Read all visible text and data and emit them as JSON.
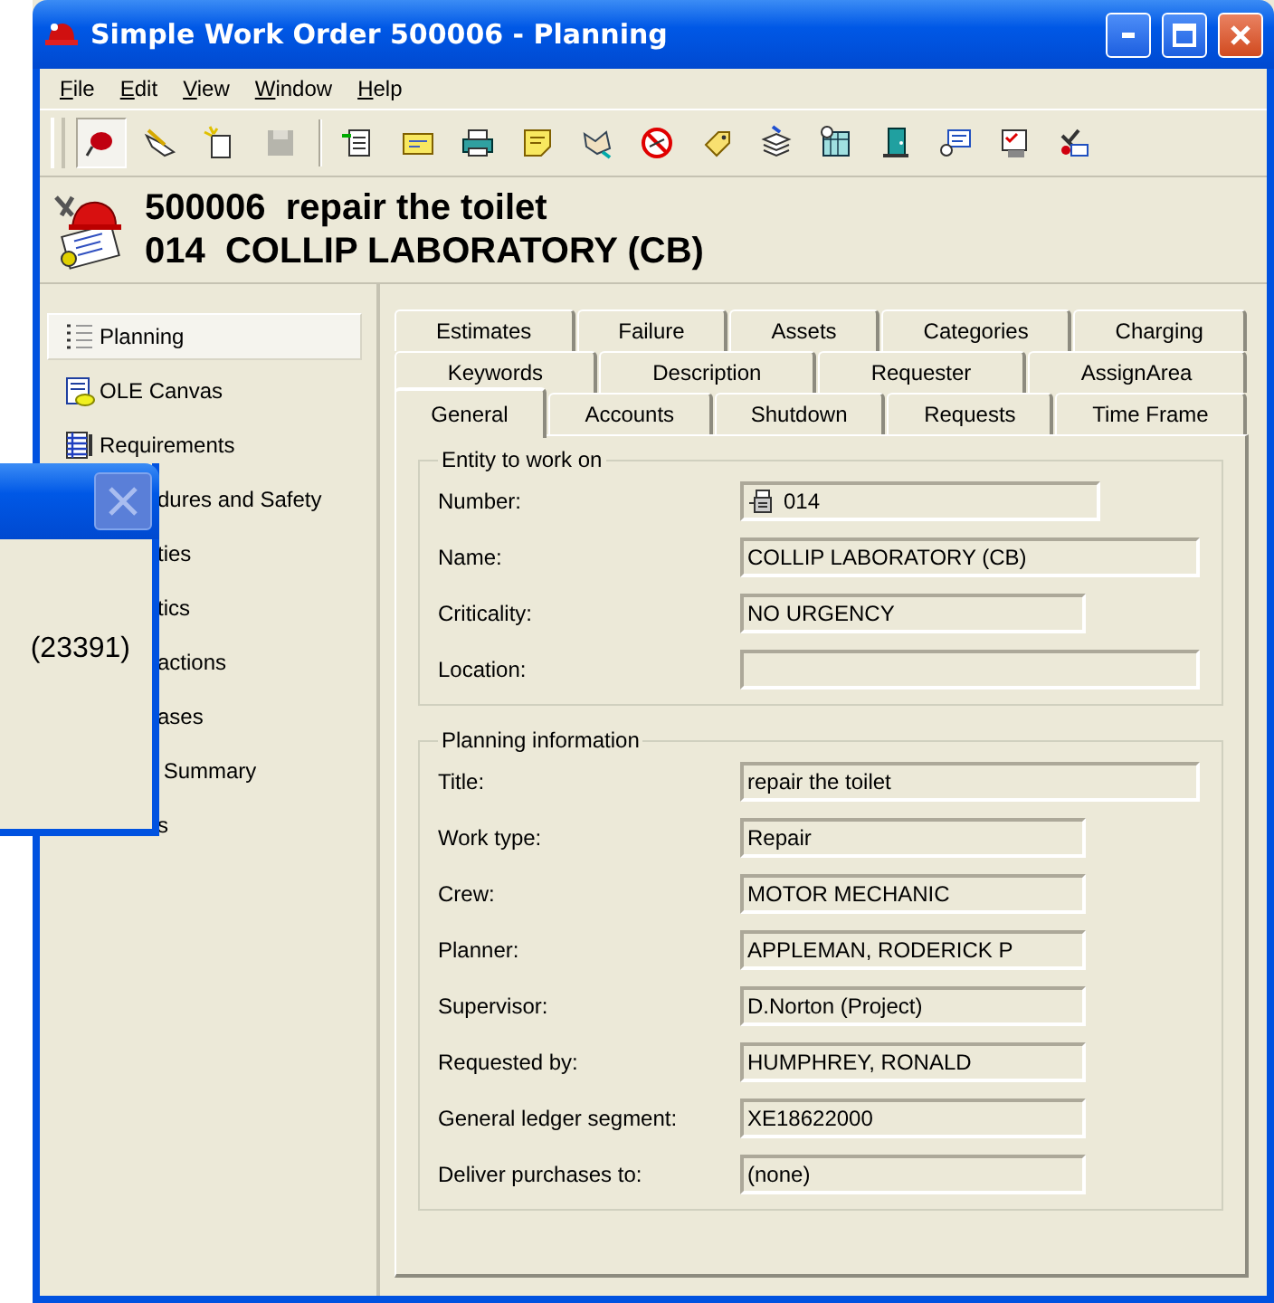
{
  "window": {
    "title": "Simple Work Order 500006 - Planning"
  },
  "menu": [
    "File",
    "Edit",
    "View",
    "Window",
    "Help"
  ],
  "toolbar": [
    {
      "buttons": [
        {
          "pressed": true,
          "disabled": false
        },
        {
          "pressed": false,
          "disabled": false
        },
        {
          "pressed": false,
          "disabled": false
        },
        {
          "pressed": false,
          "disabled": true
        }
      ]
    },
    {
      "buttons": [
        {
          "pressed": false,
          "disabled": false
        },
        {
          "pressed": false,
          "disabled": false
        },
        {
          "pressed": false,
          "disabled": false
        },
        {
          "pressed": false,
          "disabled": false
        },
        {
          "pressed": false,
          "disabled": false
        },
        {
          "pressed": false,
          "disabled": false
        },
        {
          "pressed": false,
          "disabled": false
        },
        {
          "pressed": false,
          "disabled": false
        },
        {
          "pressed": false,
          "disabled": false
        },
        {
          "pressed": false,
          "disabled": false
        },
        {
          "pressed": false,
          "disabled": false
        },
        {
          "pressed": false,
          "disabled": false
        },
        {
          "pressed": false,
          "disabled": false
        }
      ]
    }
  ],
  "header": {
    "line_1": "500006  repair the toilet",
    "line_2": "014  COLLIP LABORATORY (CB)"
  },
  "sidebar": {
    "items": [
      {
        "label": "Planning",
        "selected": true,
        "covered": false
      },
      {
        "label": "OLE Canvas",
        "selected": false,
        "covered": false
      },
      {
        "label": "Requirements",
        "selected": false,
        "covered": false
      },
      {
        "label": "dures and Safety",
        "selected": false,
        "covered": true
      },
      {
        "label": "ties",
        "selected": false,
        "covered": true
      },
      {
        "label": "tics",
        "selected": false,
        "covered": true
      },
      {
        "label": "actions",
        "selected": false,
        "covered": true
      },
      {
        "label": "ases",
        "selected": false,
        "covered": true
      },
      {
        "label": " Summary",
        "selected": false,
        "covered": true
      },
      {
        "label": "s",
        "selected": false,
        "covered": true
      }
    ]
  },
  "dialog": {
    "close_disabled": true,
    "text": "(23391)"
  },
  "tab_rows": [
    {
      "tabs": [
        {
          "label": "Estimates",
          "selected": false
        },
        {
          "label": "Failure",
          "selected": false
        },
        {
          "label": "Assets",
          "selected": false
        },
        {
          "label": "Categories",
          "selected": false
        },
        {
          "label": "Charging",
          "selected": false
        }
      ]
    },
    {
      "tabs": [
        {
          "label": "Keywords",
          "selected": false
        },
        {
          "label": "Description",
          "selected": false
        },
        {
          "label": "Requester",
          "selected": false
        },
        {
          "label": "AssignArea",
          "selected": false
        }
      ]
    },
    {
      "tabs": [
        {
          "label": "General",
          "selected": true
        },
        {
          "label": "Accounts",
          "selected": false
        },
        {
          "label": "Shutdown",
          "selected": false
        },
        {
          "label": "Requests",
          "selected": false
        },
        {
          "label": "Time Frame",
          "selected": false
        }
      ]
    }
  ],
  "groups": [
    {
      "title": "Entity to work on",
      "fields": [
        {
          "label": "Number:",
          "value": "014",
          "kind": "entity"
        },
        {
          "label": "Name:",
          "value": "COLLIP LABORATORY (CB)",
          "kind": "long"
        },
        {
          "label": "Criticality:",
          "value": "NO URGENCY",
          "kind": "medium"
        },
        {
          "label": "Location:",
          "kind": "long"
        }
      ]
    },
    {
      "title": "Planning information",
      "fields": [
        {
          "label": "Title:",
          "value": "repair the toilet",
          "kind": "long"
        },
        {
          "label": "Work type:",
          "value": "Repair",
          "kind": "medium"
        },
        {
          "label": "Crew:",
          "value": "MOTOR MECHANIC",
          "kind": "medium"
        },
        {
          "label": "Planner:",
          "value": "APPLEMAN, RODERICK P",
          "kind": "medium"
        },
        {
          "label": "Supervisor:",
          "value": "D.Norton (Project)",
          "kind": "medium"
        },
        {
          "label": "Requested by:",
          "value": "HUMPHREY, RONALD",
          "kind": "medium"
        },
        {
          "label": "General ledger segment:",
          "value": "XE18622000",
          "kind": "medium"
        },
        {
          "label": "Deliver purchases to:",
          "value": "(none)",
          "kind": "medium"
        }
      ]
    }
  ]
}
